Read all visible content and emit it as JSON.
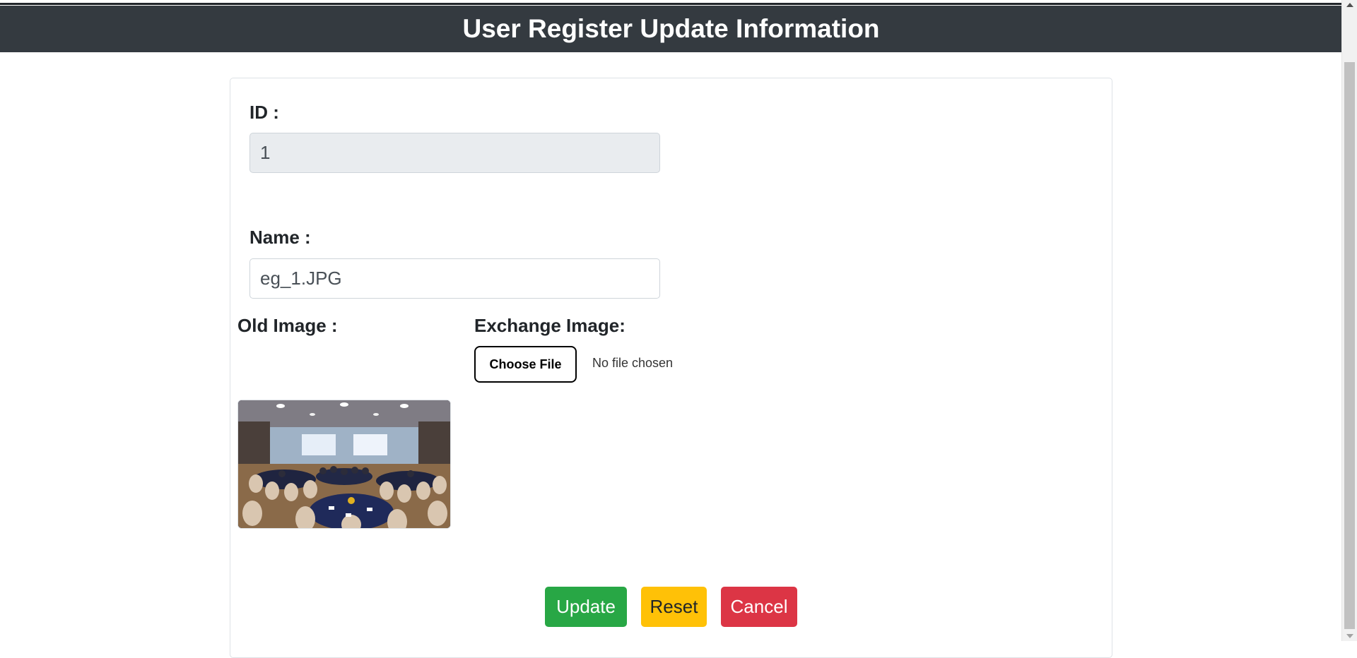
{
  "header": {
    "title": "User Register Update Information"
  },
  "form": {
    "id_label": "ID :",
    "id_value": "1",
    "name_label": "Name :",
    "name_value": "eg_1.JPG",
    "old_image_label": "Old Image :",
    "exchange_image_label": "Exchange Image:",
    "choose_file_label": "Choose File",
    "file_status": "No file chosen"
  },
  "buttons": {
    "update": "Update",
    "reset": "Reset",
    "cancel": "Cancel"
  },
  "colors": {
    "header_bg": "#343a40",
    "update": "#28a745",
    "reset": "#ffc107",
    "cancel": "#dc3545"
  }
}
